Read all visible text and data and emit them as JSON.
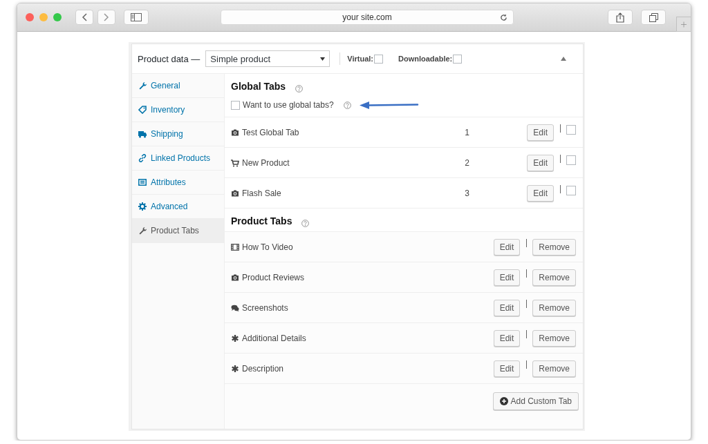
{
  "browser": {
    "address": "your site.com"
  },
  "product_data": {
    "label": "Product data —",
    "type_select": "Simple product",
    "virtual": {
      "label": "Virtual:",
      "checked": false
    },
    "downloadable": {
      "label": "Downloadable:",
      "checked": false
    }
  },
  "sidebar": [
    {
      "label": "General",
      "kind": "wrench",
      "selected": false
    },
    {
      "label": "Inventory",
      "kind": "tag",
      "selected": false
    },
    {
      "label": "Shipping",
      "kind": "truck",
      "selected": false
    },
    {
      "label": "Linked Products",
      "kind": "link",
      "selected": false
    },
    {
      "label": "Attributes",
      "kind": "list",
      "selected": false
    },
    {
      "label": "Advanced",
      "kind": "gear",
      "selected": false
    },
    {
      "label": "Product Tabs",
      "kind": "wrench",
      "selected": true
    }
  ],
  "global_tabs": {
    "title": "Global Tabs",
    "use_global": {
      "label": "Want to use global tabs?",
      "checked": false
    },
    "rows": [
      {
        "name": "Test Global Tab",
        "kind": "camera",
        "order": "1",
        "edit": "Edit",
        "checked": false
      },
      {
        "name": "New Product",
        "kind": "cart",
        "order": "2",
        "edit": "Edit",
        "checked": false
      },
      {
        "name": "Flash Sale",
        "kind": "camera",
        "order": "3",
        "edit": "Edit",
        "checked": false
      }
    ]
  },
  "product_tabs": {
    "title": "Product Tabs",
    "rows": [
      {
        "name": "How To Video",
        "kind": "film",
        "edit": "Edit",
        "remove": "Remove"
      },
      {
        "name": "Product Reviews",
        "kind": "camera",
        "edit": "Edit",
        "remove": "Remove"
      },
      {
        "name": "Screenshots",
        "kind": "comments",
        "edit": "Edit",
        "remove": "Remove"
      },
      {
        "name": "Additional Details",
        "kind": "asterisk",
        "edit": "Edit",
        "remove": "Remove"
      },
      {
        "name": "Description",
        "kind": "asterisk",
        "edit": "Edit",
        "remove": "Remove"
      }
    ]
  },
  "add_button": "Add Custom Tab"
}
